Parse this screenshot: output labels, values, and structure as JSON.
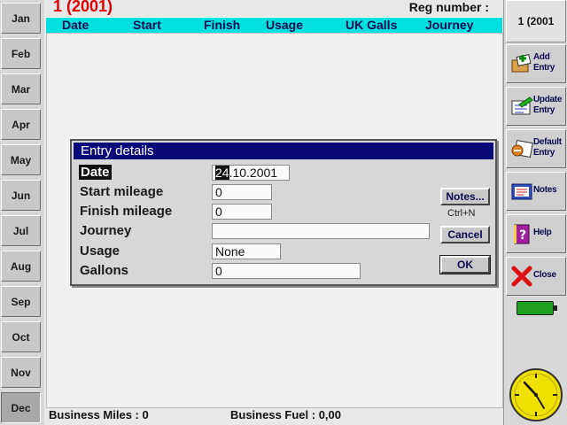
{
  "months": [
    "Jan",
    "Feb",
    "Mar",
    "Apr",
    "May",
    "Jun",
    "Jul",
    "Aug",
    "Sep",
    "Oct",
    "Nov",
    "Dec"
  ],
  "active_month": "Dec",
  "header": {
    "title": "1 (2001)",
    "reg_label": "Reg number :",
    "columns": [
      "Date",
      "Start",
      "Finish",
      "Usage",
      "UK Galls",
      "Journey"
    ]
  },
  "footer": {
    "miles": "Business Miles : 0",
    "fuel": "Business Fuel : 0,00"
  },
  "dialog": {
    "title": "Entry details",
    "date_label": "Date",
    "date_day": "24",
    "date_rest": ".10.2001",
    "start_label": "Start mileage",
    "start_value": "0",
    "finish_label": "Finish mileage",
    "finish_value": "0",
    "journey_label": "Journey",
    "journey_value": "",
    "usage_label": "Usage",
    "usage_value": "None",
    "gallons_label": "Gallons",
    "gallons_value": "0",
    "notes_btn": "Notes...",
    "notes_shortcut": "Ctrl+N",
    "cancel_btn": "Cancel",
    "ok_btn": "OK"
  },
  "toolbar": {
    "year": "1 (2001",
    "add": "Add Entry",
    "update": "Update Entry",
    "default": "Default Entry",
    "notes": "Notes",
    "help": "Help",
    "close": "Close"
  },
  "colors": {
    "header_title": "#e00000",
    "column_bar": "#00e0e0",
    "dialog_title_bg": "#0a0a7a",
    "battery": "#20a020",
    "clock_face": "#f0e000"
  }
}
